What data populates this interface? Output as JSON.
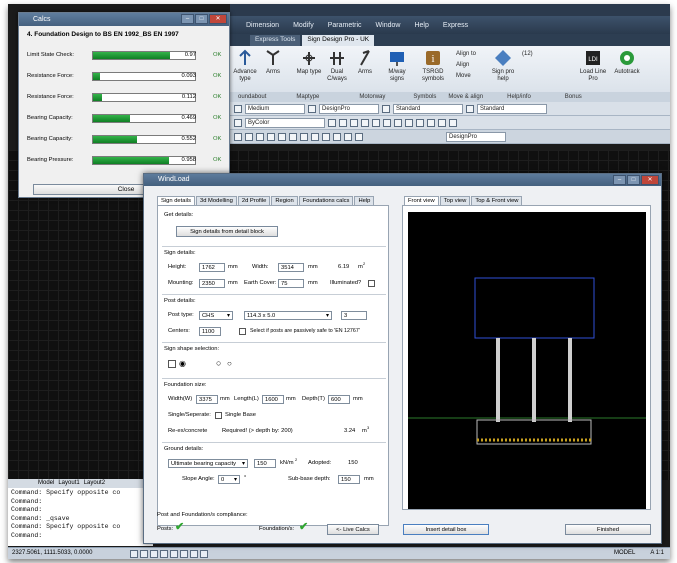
{
  "acad": {
    "menu": [
      "Dimension",
      "Modify",
      "Parametric",
      "Window",
      "Help",
      "Express"
    ],
    "tabs": [
      "Express Tools",
      "Sign Design Pro - UK"
    ],
    "ribbon": {
      "buttons": [
        "Advance type",
        "Arms",
        "Map type",
        "Dual C/ways",
        "Arms",
        "M/way signs",
        "TSRGD symbols",
        "Sign pro help",
        "Load Line Pro",
        "Autotrack"
      ],
      "small": [
        "Align to",
        "Align",
        "Move",
        "(12)"
      ],
      "footer": [
        "oundabout",
        "Maptype",
        "Motorway",
        "Symbols",
        "Move & align",
        "Help/info",
        "Bonus"
      ]
    },
    "toolbar1": {
      "medium": "Medium",
      "designpro": "DesignPro",
      "standard1": "Standard",
      "standard2": "Standard"
    },
    "toolbar2": {
      "bycolor": "ByColor",
      "designpro": "DesignPro"
    },
    "model_tabs": [
      "Model",
      "Layout1",
      "Layout2"
    ],
    "command_lines": [
      "Command: Specify opposite co",
      "Command:",
      "Command:",
      "Command: _qsave",
      "Command: Specify opposite co",
      "Command:"
    ],
    "status": {
      "coords": "2327.5061, 1111.5033, 0.0000",
      "model": "MODEL",
      "scale": "A 1:1"
    }
  },
  "calcs": {
    "title": "Calcs",
    "heading": "4. Foundation Design to BS EN 1992_BS EN 1997",
    "rows": [
      {
        "label": "Limit State Check:",
        "value": "0.97",
        "fill": 0.97,
        "status": "OK"
      },
      {
        "label": "Resistance Force:",
        "value": "0.093",
        "fill": 0.09,
        "status": "OK"
      },
      {
        "label": "Resistance Force:",
        "value": "0.112",
        "fill": 0.11,
        "status": "OK"
      },
      {
        "label": "Bearing Capacity:",
        "value": "0.469",
        "fill": 0.47,
        "status": "OK"
      },
      {
        "label": "Bearing Capacity:",
        "value": "0.552",
        "fill": 0.55,
        "status": "OK"
      },
      {
        "label": "Bearing Pressure:",
        "value": "0.958",
        "fill": 0.96,
        "status": "OK"
      }
    ],
    "close": "Close"
  },
  "wind": {
    "title": "WindLoad",
    "tabs": [
      "Sign details",
      "3d Modelling",
      "2d Profile",
      "Region",
      "Foundations calcs",
      "Help"
    ],
    "view_tabs": [
      "Front view",
      "Top view",
      "Top & Front view"
    ],
    "get_details": "Get details:",
    "sign_details_btn": "Sign details from detail block",
    "sign_details": "Sign details:",
    "height_lbl": "Height:",
    "height": "1762",
    "mm1": "mm",
    "width_lbl": "Width:",
    "width": "3514",
    "mm2": "mm",
    "area": "6.19",
    "m2": "m",
    "mounting_lbl": "Mounting:",
    "mounting": "2350",
    "mm3": "mm",
    "earth_lbl": "Earth Cover:",
    "earth": "75",
    "mm4": "mm",
    "illuminated": "Illuminated?",
    "post_details": "Post details:",
    "post_type_lbl": "Post type:",
    "post_type": "CHS",
    "post_size": "114.3 x 5.0",
    "post_count": "3",
    "centers_lbl": "Centers:",
    "centers": "1100",
    "passive_lbl": "Select if posts are passively safe to 'EN 12767'",
    "shape_sel": "Sign shape selection:",
    "foundation_size": "Foundation size:",
    "fwidth_lbl": "Width(W)",
    "fwidth": "3375",
    "fmm1": "mm",
    "flength_lbl": "Length(L)",
    "flength": "1600",
    "fmm2": "mm",
    "fdepth_lbl": "Depth(T)",
    "fdepth": "600",
    "fmm3": "mm",
    "single_lbl": "Single/Seperate:",
    "single_base": "Single Base",
    "reexc_lbl": "Re-ex/concrete",
    "required": "Required! (> depth by: 200)",
    "volume": "3.24",
    "m3": "m",
    "ground": "Ground details:",
    "ult_lbl": "Ultimate bearing capacity",
    "ult": "150",
    "kn": "kN/m",
    "adopted_lbl": "Adopted:",
    "adopted": "150",
    "slope_lbl": "Slope Angle:",
    "slope": "0",
    "deg": "°",
    "subbase_lbl": "Sub-base depth:",
    "subbase": "150",
    "mm5": "mm",
    "compliance": "Post and Foundation/s compliance:",
    "posts_lbl": "Posts:",
    "foundation_lbl": "Foundation/s:",
    "live_calcs": "<- Live Calcs",
    "insert": "Insert detail box",
    "finished": "Finished"
  }
}
